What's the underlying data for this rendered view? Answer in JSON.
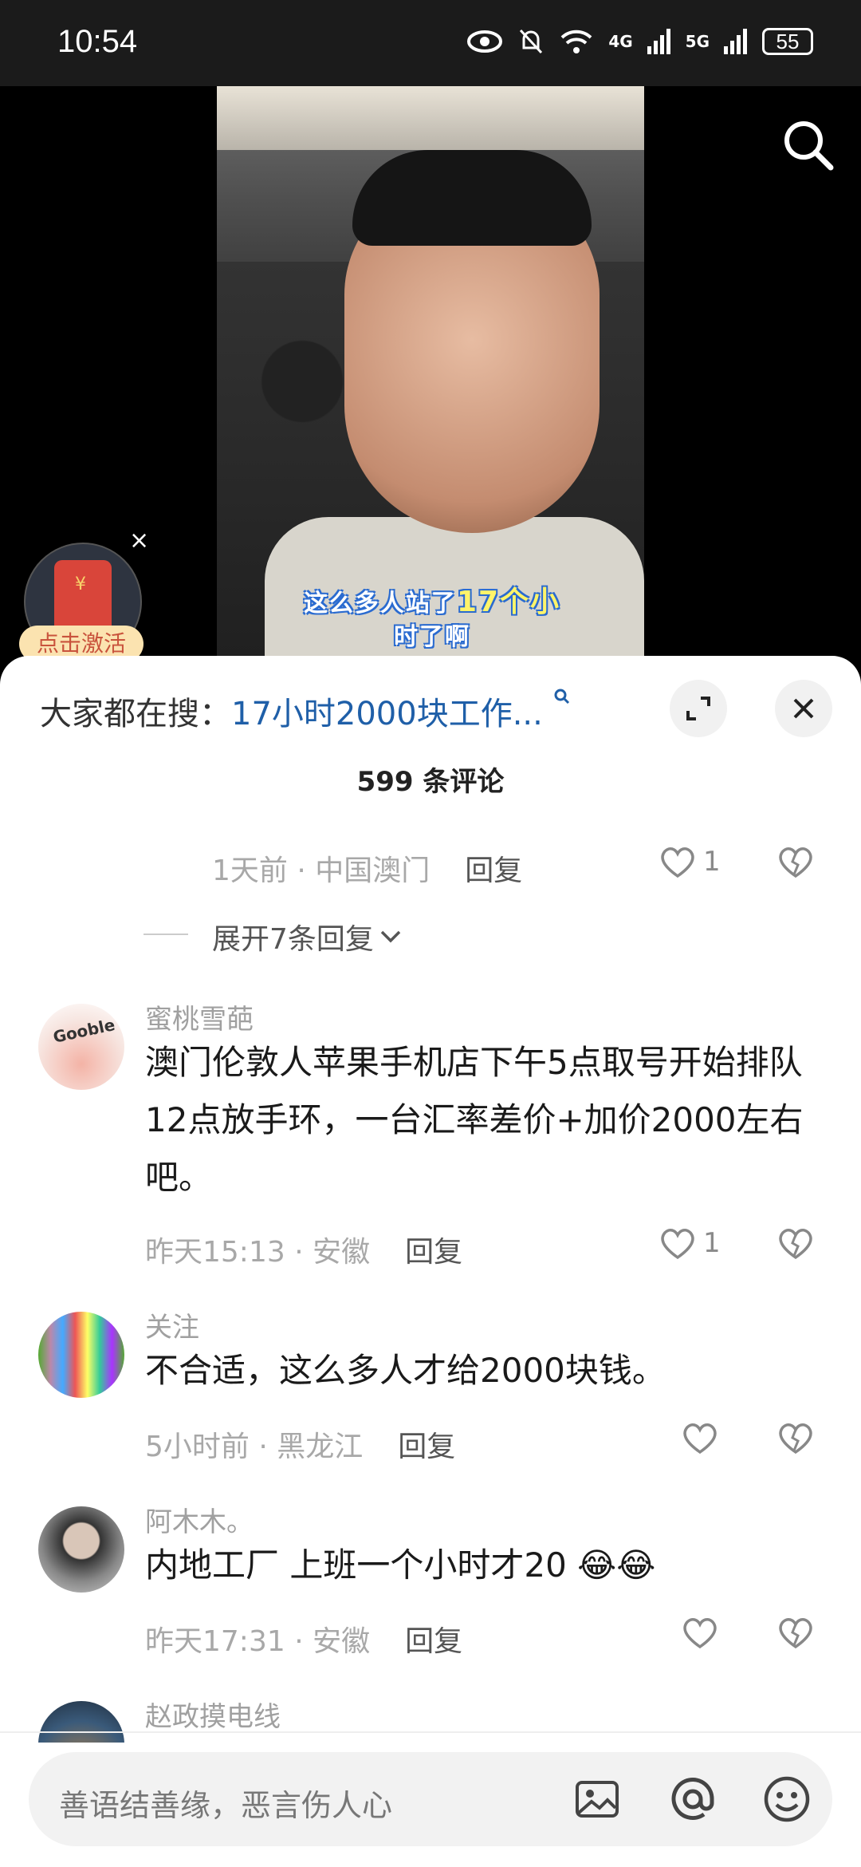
{
  "status_bar": {
    "time": "10:54",
    "net1": "4G",
    "net2": "5G",
    "battery": "55"
  },
  "video": {
    "caption_line1_a": "这么多人站了",
    "caption_line1_b": "17个小",
    "caption_line2": "时了啊"
  },
  "red_packet": {
    "label": "点击激活",
    "close": "×"
  },
  "sheet": {
    "search_prefix": "大家都在搜：",
    "search_query": "17小时2000块工作...",
    "comment_count": "599 条评论"
  },
  "top_meta": {
    "time": "1天前 · 中国澳门",
    "reply": "回复",
    "likes": "1"
  },
  "expand_replies": "展开7条回复",
  "comments": [
    {
      "name": "蜜桃雪葩",
      "text": "澳门伦敦人苹果手机店下午5点取号开始排队12点放手环，一台汇率差价+加价2000左右吧。",
      "meta": "昨天15:13 · 安徽",
      "reply": "回复",
      "likes": "1",
      "avatar_text": "Gooble"
    },
    {
      "name": "关注",
      "text": "不合适，这么多人才给2000块钱。",
      "meta": "5小时前 · 黑龙江",
      "reply": "回复",
      "likes": ""
    },
    {
      "name": "阿木木。",
      "text": "内地工厂 上班一个小时才20 😂😂",
      "meta": "昨天17:31 · 安徽",
      "reply": "回复",
      "likes": ""
    },
    {
      "name": "赵政摸电线"
    }
  ],
  "input": {
    "placeholder": "善语结善缘，恶言伤人心",
    "icons": [
      "image-icon",
      "at-icon",
      "emoji-icon"
    ]
  }
}
